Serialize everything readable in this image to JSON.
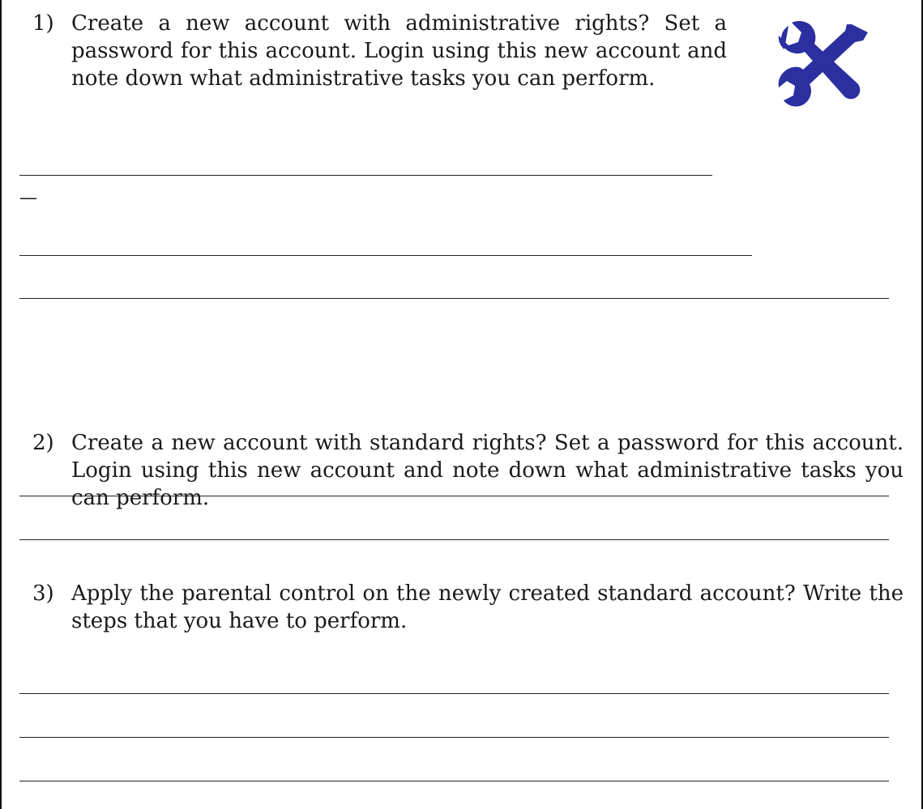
{
  "questions": [
    {
      "number": "1)",
      "text": "Create a new account with administrative rights? Set a password for this account. Login using this new account and note down what administrative tasks you can perform."
    },
    {
      "number": "2)",
      "text": "Create a new account with standard rights? Set a password for this account. Login using this new account and note down what administrative tasks you can perform."
    },
    {
      "number": "3)",
      "text": "Apply the parental control on the newly created standard account? Write the steps that you have to perform."
    }
  ],
  "stray_dash": "—",
  "icon": {
    "name": "tools-icon",
    "color": "#2b2fa0"
  }
}
